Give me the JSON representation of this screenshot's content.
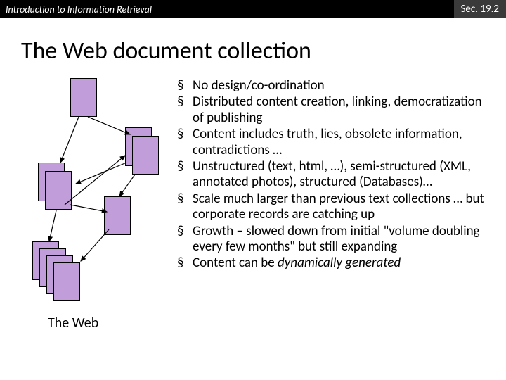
{
  "header": {
    "left": "Introduction to Information Retrieval",
    "right": "Sec. 19.2"
  },
  "title": "The Web document collection",
  "diagram": {
    "caption": "The Web"
  },
  "bullets": [
    {
      "text": "No design/co-ordination"
    },
    {
      "text": "Distributed content creation, linking, democratization of publishing"
    },
    {
      "text": "Content includes truth, lies, obsolete information, contradictions …"
    },
    {
      "text": "Unstructured (text, html, …), semi-structured (XML, annotated photos), structured (Databases)…"
    },
    {
      "text": "Scale much larger than previous text collections … but corporate records are catching up"
    },
    {
      "html": "Growth – slowed down from initial \"volume doubling every few months\" but still expanding"
    },
    {
      "html": "Content can be <em>dynamically generated</em>"
    }
  ]
}
